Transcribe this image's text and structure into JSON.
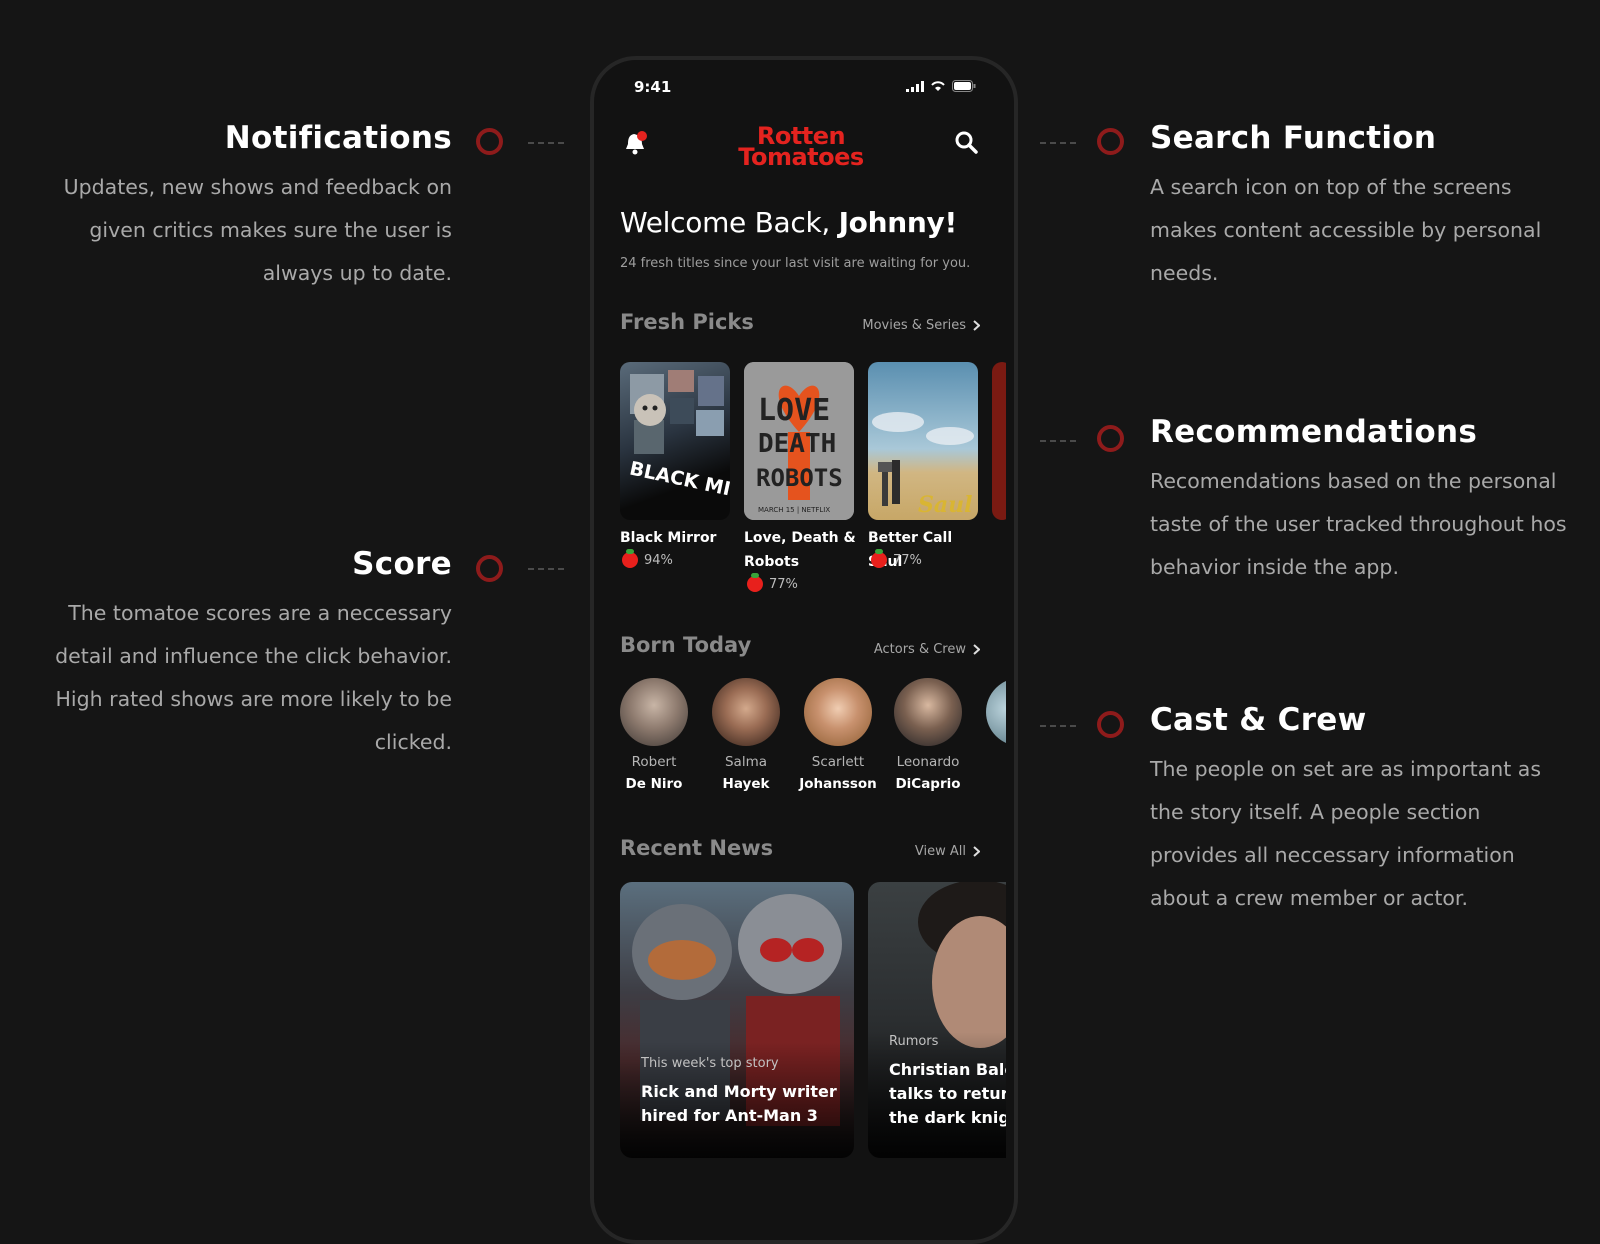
{
  "annotations": {
    "notifications": {
      "title": "Notifications",
      "body": "Updates, new shows and feedback on given critics makes sure the user is always up to date."
    },
    "score": {
      "title": "Score",
      "body": "The tomatoe scores are a neccessary detail and influence the click behavior. High rated shows are more likely to be clicked."
    },
    "search": {
      "title": "Search Function",
      "body": "A search icon on top of the screens makes content accessible by personal needs."
    },
    "recommendations": {
      "title": "Recommendations",
      "body": "Recomendations based on the personal taste of the user tracked throughout hos behavior inside the app."
    },
    "cast": {
      "title": "Cast & Crew",
      "body": "The people on set are as important as the story itself. A people section provides all neccessary information about a crew member or actor."
    }
  },
  "app": {
    "status_time": "9:41",
    "logo_line1": "Rotten",
    "logo_line2": "Tomatoes",
    "welcome_prefix": "Welcome Back, ",
    "welcome_name": "Johnny!",
    "subtitle": "24 fresh titles since your last visit are waiting for you.",
    "fresh_picks": {
      "title": "Fresh Picks",
      "link": "Movies & Series",
      "items": [
        {
          "title": "Black Mirror",
          "score": "94%",
          "poster_text": "BLACK MIRROR"
        },
        {
          "title": "Love, Death & Robots",
          "score": "77%",
          "poster_text": "LOVE DEATH + ROBOTS",
          "poster_small": "MARCH 15 | NETFLIX"
        },
        {
          "title": "Better Call Saul",
          "score": "77%",
          "poster_text": "Saul"
        }
      ]
    },
    "born_today": {
      "title": "Born Today",
      "link": "Actors & Crew",
      "people": [
        {
          "first": "Robert",
          "last": "De Niro"
        },
        {
          "first": "Salma",
          "last": "Hayek"
        },
        {
          "first": "Scarlett",
          "last": "Johansson"
        },
        {
          "first": "Leonardo",
          "last": "DiCaprio"
        }
      ]
    },
    "recent_news": {
      "title": "Recent News",
      "link": "View All",
      "items": [
        {
          "tag": "This week's top story",
          "headline": "Rick and Morty writer hired for Ant-Man 3"
        },
        {
          "tag": "Rumors",
          "headline": "Christian Bale talks to return the dark knigh"
        }
      ]
    }
  }
}
